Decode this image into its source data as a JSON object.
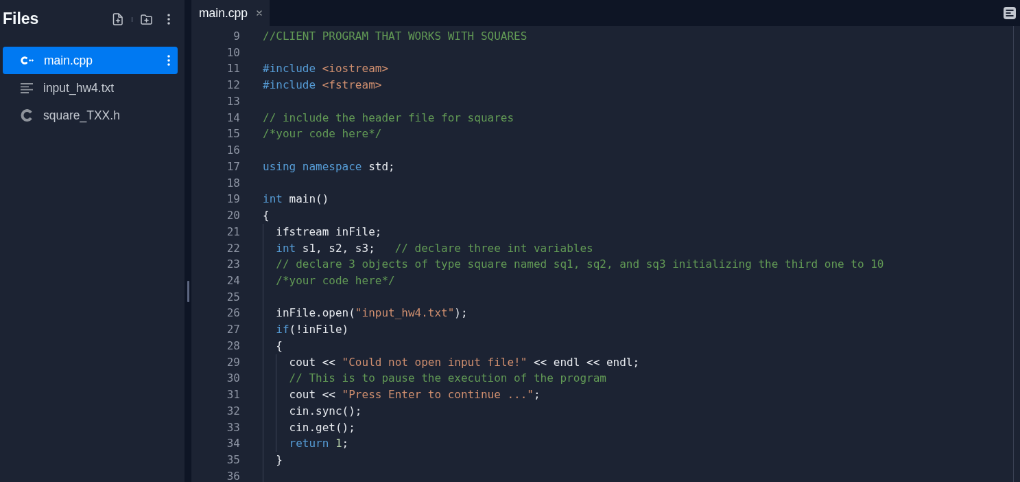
{
  "sidebar": {
    "title": "Files",
    "files": [
      {
        "name": "main.cpp",
        "kind": "cpp",
        "selected": true
      },
      {
        "name": "input_hw4.txt",
        "kind": "text",
        "selected": false
      },
      {
        "name": "square_TXX.h",
        "kind": "header",
        "selected": false
      }
    ]
  },
  "tabs": [
    {
      "label": "main.cpp",
      "selected": true
    }
  ],
  "editor": {
    "lines": [
      {
        "number": "9",
        "tokens": [
          {
            "kind": "comment",
            "text": "//CLIENT PROGRAM THAT WORKS WITH SQUARES"
          }
        ]
      },
      {
        "number": "10"
      },
      {
        "number": "11",
        "tokens": [
          {
            "kind": "keyword",
            "text": "#include "
          },
          {
            "kind": "string",
            "text": "<iostream>"
          }
        ]
      },
      {
        "number": "12",
        "tokens": [
          {
            "kind": "keyword",
            "text": "#include "
          },
          {
            "kind": "string",
            "text": "<fstream>"
          }
        ]
      },
      {
        "number": "13"
      },
      {
        "number": "14",
        "tokens": [
          {
            "kind": "comment",
            "text": "// include the header file for squares"
          }
        ]
      },
      {
        "number": "15",
        "tokens": [
          {
            "kind": "comment",
            "text": "/*your code here*/"
          }
        ]
      },
      {
        "number": "16"
      },
      {
        "number": "17",
        "tokens": [
          {
            "kind": "keyword",
            "text": "using namespace"
          },
          {
            "kind": "plain",
            "text": " std;"
          }
        ]
      },
      {
        "number": "18"
      },
      {
        "number": "19",
        "tokens": [
          {
            "kind": "keyword",
            "text": "int"
          },
          {
            "kind": "plain",
            "text": " main()"
          }
        ]
      },
      {
        "number": "20",
        "tokens": [
          {
            "kind": "plain",
            "text": "{"
          }
        ]
      },
      {
        "number": "21",
        "tokens": [
          {
            "kind": "plain",
            "text": "  ifstream inFile;"
          }
        ]
      },
      {
        "number": "22",
        "tokens": [
          {
            "kind": "keyword",
            "text": "  int"
          },
          {
            "kind": "plain",
            "text": " s1, s2, s3;   "
          },
          {
            "kind": "comment",
            "text": "// declare three int variables"
          }
        ]
      },
      {
        "number": "23",
        "tokens": [
          {
            "kind": "comment",
            "text": "  // declare 3 objects of type square named sq1, sq2, and sq3 initializing the third one to 10"
          }
        ]
      },
      {
        "number": "24",
        "tokens": [
          {
            "kind": "comment",
            "text": "  /*your code here*/"
          }
        ]
      },
      {
        "number": "25"
      },
      {
        "number": "26",
        "tokens": [
          {
            "kind": "plain",
            "text": "  inFile.open("
          },
          {
            "kind": "string",
            "text": "\"input_hw4.txt\""
          },
          {
            "kind": "plain",
            "text": ");"
          }
        ]
      },
      {
        "number": "27",
        "tokens": [
          {
            "kind": "keyword",
            "text": "  if"
          },
          {
            "kind": "plain",
            "text": "(!inFile)"
          }
        ]
      },
      {
        "number": "28",
        "tokens": [
          {
            "kind": "plain",
            "text": "  {"
          }
        ]
      },
      {
        "number": "29",
        "tokens": [
          {
            "kind": "plain",
            "text": "    cout << "
          },
          {
            "kind": "string",
            "text": "\"Could not open input file!\""
          },
          {
            "kind": "plain",
            "text": " << endl << endl;"
          }
        ]
      },
      {
        "number": "30",
        "tokens": [
          {
            "kind": "comment",
            "text": "    // This is to pause the execution of the program"
          }
        ]
      },
      {
        "number": "31",
        "tokens": [
          {
            "kind": "plain",
            "text": "    cout << "
          },
          {
            "kind": "string",
            "text": "\"Press Enter to continue ...\""
          },
          {
            "kind": "plain",
            "text": ";"
          }
        ]
      },
      {
        "number": "32",
        "tokens": [
          {
            "kind": "plain",
            "text": "    cin.sync();"
          }
        ]
      },
      {
        "number": "33",
        "tokens": [
          {
            "kind": "plain",
            "text": "    cin.get();"
          }
        ]
      },
      {
        "number": "34",
        "tokens": [
          {
            "kind": "keyword",
            "text": "    return "
          },
          {
            "kind": "number",
            "text": "1"
          },
          {
            "kind": "plain",
            "text": ";"
          }
        ]
      },
      {
        "number": "35",
        "tokens": [
          {
            "kind": "plain",
            "text": "  }"
          }
        ]
      },
      {
        "number": "36"
      }
    ]
  }
}
